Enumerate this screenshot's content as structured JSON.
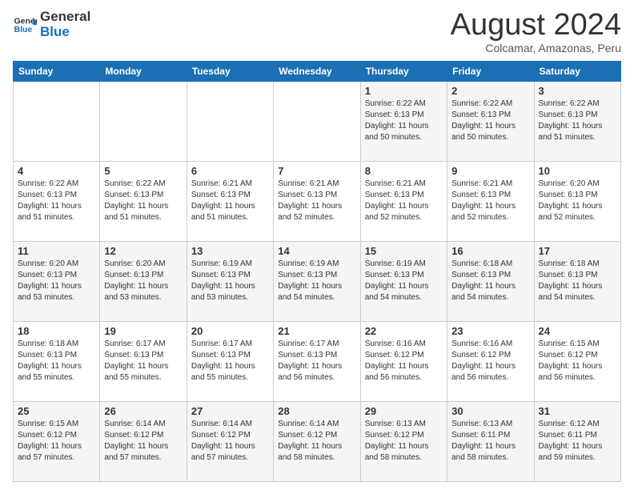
{
  "logo": {
    "line1": "General",
    "line2": "Blue"
  },
  "header": {
    "title": "August 2024",
    "subtitle": "Colcamar, Amazonas, Peru"
  },
  "weekdays": [
    "Sunday",
    "Monday",
    "Tuesday",
    "Wednesday",
    "Thursday",
    "Friday",
    "Saturday"
  ],
  "weeks": [
    [
      {
        "day": "",
        "detail": ""
      },
      {
        "day": "",
        "detail": ""
      },
      {
        "day": "",
        "detail": ""
      },
      {
        "day": "",
        "detail": ""
      },
      {
        "day": "1",
        "detail": "Sunrise: 6:22 AM\nSunset: 6:13 PM\nDaylight: 11 hours\nand 50 minutes."
      },
      {
        "day": "2",
        "detail": "Sunrise: 6:22 AM\nSunset: 6:13 PM\nDaylight: 11 hours\nand 50 minutes."
      },
      {
        "day": "3",
        "detail": "Sunrise: 6:22 AM\nSunset: 6:13 PM\nDaylight: 11 hours\nand 51 minutes."
      }
    ],
    [
      {
        "day": "4",
        "detail": "Sunrise: 6:22 AM\nSunset: 6:13 PM\nDaylight: 11 hours\nand 51 minutes."
      },
      {
        "day": "5",
        "detail": "Sunrise: 6:22 AM\nSunset: 6:13 PM\nDaylight: 11 hours\nand 51 minutes."
      },
      {
        "day": "6",
        "detail": "Sunrise: 6:21 AM\nSunset: 6:13 PM\nDaylight: 11 hours\nand 51 minutes."
      },
      {
        "day": "7",
        "detail": "Sunrise: 6:21 AM\nSunset: 6:13 PM\nDaylight: 11 hours\nand 52 minutes."
      },
      {
        "day": "8",
        "detail": "Sunrise: 6:21 AM\nSunset: 6:13 PM\nDaylight: 11 hours\nand 52 minutes."
      },
      {
        "day": "9",
        "detail": "Sunrise: 6:21 AM\nSunset: 6:13 PM\nDaylight: 11 hours\nand 52 minutes."
      },
      {
        "day": "10",
        "detail": "Sunrise: 6:20 AM\nSunset: 6:13 PM\nDaylight: 11 hours\nand 52 minutes."
      }
    ],
    [
      {
        "day": "11",
        "detail": "Sunrise: 6:20 AM\nSunset: 6:13 PM\nDaylight: 11 hours\nand 53 minutes."
      },
      {
        "day": "12",
        "detail": "Sunrise: 6:20 AM\nSunset: 6:13 PM\nDaylight: 11 hours\nand 53 minutes."
      },
      {
        "day": "13",
        "detail": "Sunrise: 6:19 AM\nSunset: 6:13 PM\nDaylight: 11 hours\nand 53 minutes."
      },
      {
        "day": "14",
        "detail": "Sunrise: 6:19 AM\nSunset: 6:13 PM\nDaylight: 11 hours\nand 54 minutes."
      },
      {
        "day": "15",
        "detail": "Sunrise: 6:19 AM\nSunset: 6:13 PM\nDaylight: 11 hours\nand 54 minutes."
      },
      {
        "day": "16",
        "detail": "Sunrise: 6:18 AM\nSunset: 6:13 PM\nDaylight: 11 hours\nand 54 minutes."
      },
      {
        "day": "17",
        "detail": "Sunrise: 6:18 AM\nSunset: 6:13 PM\nDaylight: 11 hours\nand 54 minutes."
      }
    ],
    [
      {
        "day": "18",
        "detail": "Sunrise: 6:18 AM\nSunset: 6:13 PM\nDaylight: 11 hours\nand 55 minutes."
      },
      {
        "day": "19",
        "detail": "Sunrise: 6:17 AM\nSunset: 6:13 PM\nDaylight: 11 hours\nand 55 minutes."
      },
      {
        "day": "20",
        "detail": "Sunrise: 6:17 AM\nSunset: 6:13 PM\nDaylight: 11 hours\nand 55 minutes."
      },
      {
        "day": "21",
        "detail": "Sunrise: 6:17 AM\nSunset: 6:13 PM\nDaylight: 11 hours\nand 56 minutes."
      },
      {
        "day": "22",
        "detail": "Sunrise: 6:16 AM\nSunset: 6:12 PM\nDaylight: 11 hours\nand 56 minutes."
      },
      {
        "day": "23",
        "detail": "Sunrise: 6:16 AM\nSunset: 6:12 PM\nDaylight: 11 hours\nand 56 minutes."
      },
      {
        "day": "24",
        "detail": "Sunrise: 6:15 AM\nSunset: 6:12 PM\nDaylight: 11 hours\nand 56 minutes."
      }
    ],
    [
      {
        "day": "25",
        "detail": "Sunrise: 6:15 AM\nSunset: 6:12 PM\nDaylight: 11 hours\nand 57 minutes."
      },
      {
        "day": "26",
        "detail": "Sunrise: 6:14 AM\nSunset: 6:12 PM\nDaylight: 11 hours\nand 57 minutes."
      },
      {
        "day": "27",
        "detail": "Sunrise: 6:14 AM\nSunset: 6:12 PM\nDaylight: 11 hours\nand 57 minutes."
      },
      {
        "day": "28",
        "detail": "Sunrise: 6:14 AM\nSunset: 6:12 PM\nDaylight: 11 hours\nand 58 minutes."
      },
      {
        "day": "29",
        "detail": "Sunrise: 6:13 AM\nSunset: 6:12 PM\nDaylight: 11 hours\nand 58 minutes."
      },
      {
        "day": "30",
        "detail": "Sunrise: 6:13 AM\nSunset: 6:11 PM\nDaylight: 11 hours\nand 58 minutes."
      },
      {
        "day": "31",
        "detail": "Sunrise: 6:12 AM\nSunset: 6:11 PM\nDaylight: 11 hours\nand 59 minutes."
      }
    ]
  ]
}
